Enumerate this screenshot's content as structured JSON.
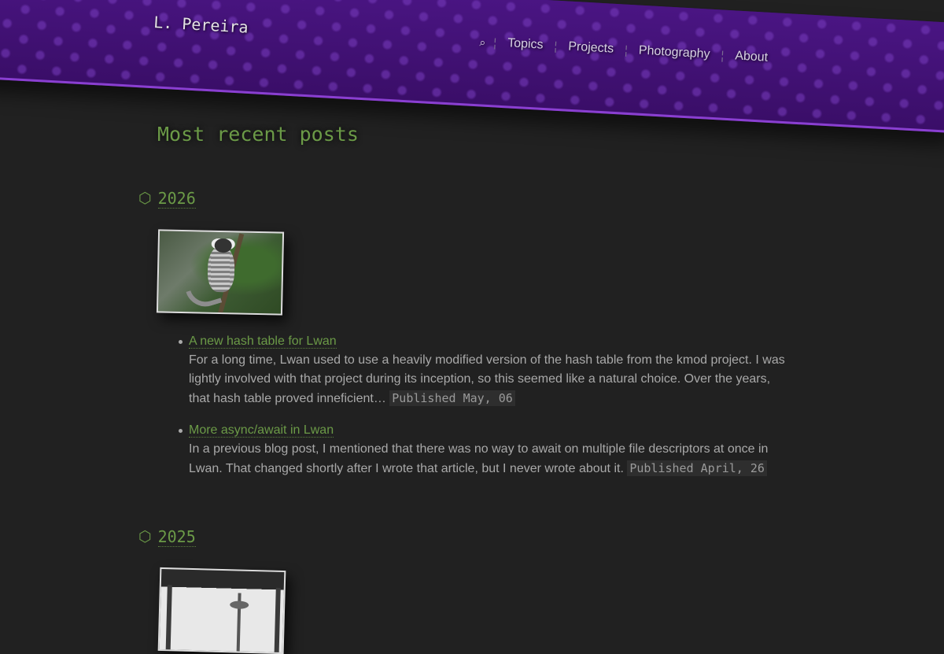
{
  "header": {
    "site_title": "L. Pereira",
    "search_icon": "⌕",
    "nav": [
      {
        "label": "Topics"
      },
      {
        "label": "Projects"
      },
      {
        "label": "Photography"
      },
      {
        "label": "About"
      }
    ],
    "accent_color": "#3c0f66"
  },
  "main": {
    "title": "Most recent posts",
    "years": [
      {
        "year": "2026",
        "thumbnail_icon": "marmoset-photo",
        "posts": [
          {
            "title": "A new hash table for Lwan",
            "summary": "For a long time, Lwan used to use a heavily modified version of the hash table from the kmod project. I was lightly involved with that project during its inception, so this seemed like a natural choice. Over the years, that hash table proved inneficient…",
            "date": "Published May, 06"
          },
          {
            "title": "More async/await in Lwan",
            "summary": "In a previous blog post, I mentioned that there was no way to await on multiple file descriptors at once in Lwan. That changed shortly after I wrote that article, but I never wrote about it.",
            "date": "Published April, 26"
          }
        ]
      },
      {
        "year": "2025",
        "thumbnail_icon": "space-needle-photo"
      }
    ],
    "link_color": "#6b9a47"
  }
}
